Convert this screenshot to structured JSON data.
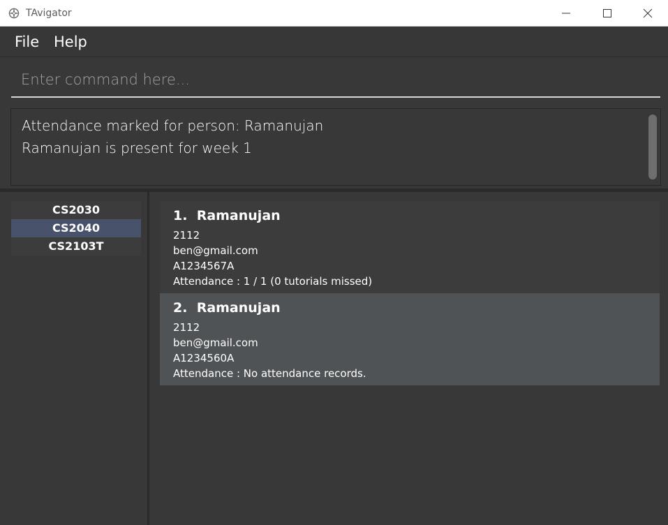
{
  "window": {
    "title": "TAvigator"
  },
  "menu": {
    "file": "File",
    "help": "Help"
  },
  "command": {
    "placeholder": "Enter command here...",
    "value": ""
  },
  "result": {
    "lines": [
      "Attendance marked for person: Ramanujan",
      "Ramanujan is present for week 1"
    ]
  },
  "courses": [
    {
      "code": "CS2030",
      "selected": false
    },
    {
      "code": "CS2040",
      "selected": true
    },
    {
      "code": "CS2103T",
      "selected": false
    }
  ],
  "persons": [
    {
      "index": "1.",
      "name": "Ramanujan",
      "phone": "2112",
      "email": "ben@gmail.com",
      "student_id": "A1234567A",
      "attendance": "Attendance : 1 / 1 (0 tutorials missed)"
    },
    {
      "index": "2.",
      "name": "Ramanujan",
      "phone": "2112",
      "email": "ben@gmail.com",
      "student_id": "A1234560A",
      "attendance": "Attendance : No attendance records."
    }
  ],
  "colors": {
    "background": "#383838",
    "selected_course": "#48536b",
    "card_alt": "#4f5356"
  },
  "icons": [
    "app-compass-icon",
    "minimize-icon",
    "maximize-icon",
    "close-icon"
  ]
}
